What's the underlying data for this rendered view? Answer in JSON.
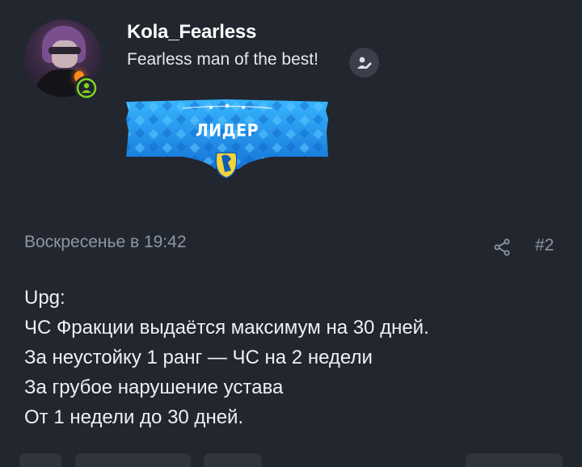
{
  "author": {
    "username": "Kola_Fearless",
    "status_text": "Fearless man of the best!",
    "online_color": "#7ed321"
  },
  "icons": {
    "online": "online-indicator-icon",
    "edit_status": "edit-status-icon",
    "share": "share-icon"
  },
  "rank_badge": {
    "label": "ЛИДЕР",
    "color": "#1e8fe6"
  },
  "post": {
    "timestamp": "Воскресенье в 19:42",
    "number": "#2",
    "lines": [
      "Upg:",
      "ЧС Фракции выдаётся максимум на 30 дней.",
      "За неустойку 1 ранг — ЧС на 2 недели",
      "За грубое нарушение устава",
      "От 1 недели до 30 дней."
    ]
  },
  "colors": {
    "background": "#22262e",
    "muted_text": "#8f96a3",
    "text": "#eef0f3"
  }
}
